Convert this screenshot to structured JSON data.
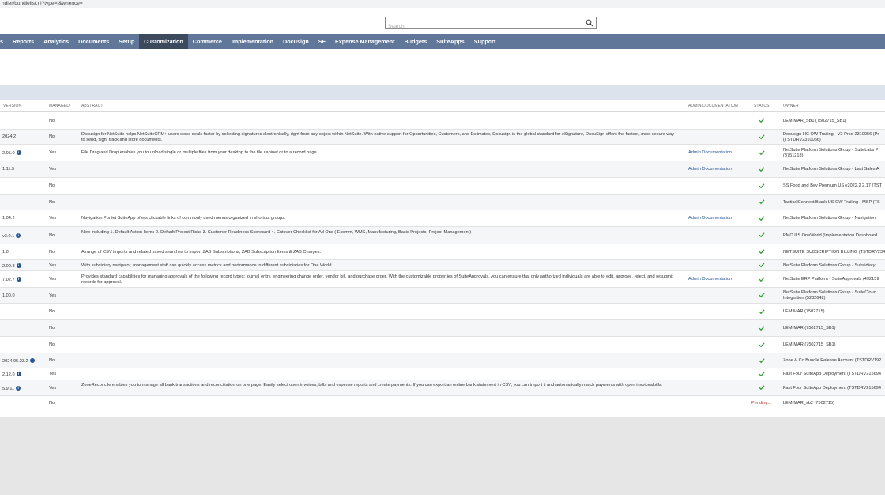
{
  "browser": {
    "url": "ndler/bundlelist.nl?type=I&whence="
  },
  "search": {
    "placeholder": "Search"
  },
  "nav": {
    "items": [
      {
        "label": "s"
      },
      {
        "label": "Reports"
      },
      {
        "label": "Analytics"
      },
      {
        "label": "Documents"
      },
      {
        "label": "Setup"
      },
      {
        "label": "Customization",
        "active": true
      },
      {
        "label": "Commerce"
      },
      {
        "label": "Implementation"
      },
      {
        "label": "Docusign"
      },
      {
        "label": "SF"
      },
      {
        "label": "Expense Management"
      },
      {
        "label": "Budgets"
      },
      {
        "label": "SuiteApps"
      },
      {
        "label": "Support"
      }
    ]
  },
  "table": {
    "headers": {
      "version": "VERSION",
      "managed": "MANAGED",
      "abstract": "ABSTRACT",
      "admin_doc": "ADMIN DOCUMENTATION",
      "status": "STATUS",
      "owner": "OWNER"
    },
    "rows": [
      {
        "version": "",
        "info": false,
        "managed": "No",
        "abstract": "",
        "admin_doc": "",
        "status": "check",
        "owner": "LEM-MAR_SB1 (7502715_SB1)"
      },
      {
        "version": "2024.2",
        "info": false,
        "managed": "No",
        "abstract": "Docusign for NetSuite helps NetSuiteCRM+ users close deals faster by collecting signatures electronically, right from any object within NetSuite. With native support for Opportunities, Customers, and Estimates, Docusign is the global standard for eSignature, DocuSign offers the fastest, most secure way to send, sign, track and store documents.",
        "admin_doc": "",
        "status": "check",
        "owner": "Docusign HC OW Trailing - V2 Prod 2310056 (Pr (TSTDRV2310056)"
      },
      {
        "version": "2.05.0",
        "info": true,
        "managed": "Yes",
        "abstract": "File Drag and Drop enables you to upload single or multiple files from your desktop to the file cabinet or to a record page.",
        "admin_doc": "Admin Documentation",
        "status": "check",
        "owner": "NetSuite Platform Solutions Group - SuiteLabs P (3751218)"
      },
      {
        "version": "1.11.5",
        "info": false,
        "managed": "Yes",
        "abstract": "",
        "admin_doc": "Admin Documentation",
        "status": "check",
        "owner": "NetSuite Platform Solutions Group - Last Sales A"
      },
      {
        "version": "",
        "info": false,
        "managed": "No",
        "abstract": "",
        "admin_doc": "",
        "status": "check",
        "owner": "SS Food and Bev Premium US v2022.2 2.17 (TST"
      },
      {
        "version": "",
        "info": false,
        "managed": "No",
        "abstract": "",
        "admin_doc": "",
        "status": "check",
        "owner": "TacticalConnect Blank US OW Trailing - MSP (TS"
      },
      {
        "version": "1.04.2",
        "info": false,
        "managed": "Yes",
        "abstract": "Navigation Portlet SuiteApp offers clickable links of commonly used menus organized in shortcut groups.",
        "admin_doc": "Admin Documentation",
        "status": "check",
        "owner": "NetSuite Platform Solutions Group - Navigation"
      },
      {
        "version": "v3.0.1",
        "info": true,
        "managed": "No",
        "abstract": "Now including 1. Default Action Items 2. Default Project Risks 3. Customer Readiness Scorecard 4. Cutover Checklist for Ad Ons ( Ecomm, WMS, Manufacturing, Basic Projects, Project Management)",
        "admin_doc": "",
        "status": "check",
        "owner": "PMO US OneWorld (Implementation Dashboard"
      },
      {
        "version": "1.0",
        "info": false,
        "managed": "No",
        "abstract": "A range of CSV imports and related saved searches to import ZAB Subscriptions, ZAB Subscription Items & ZAB Charges.",
        "admin_doc": "",
        "status": "check",
        "owner": "NETSUITE SUBSCRIPTION BILLING (TSTDRV2348"
      },
      {
        "version": "2.00.3",
        "info": true,
        "managed": "Yes",
        "abstract": "With subsidiary navigator, management staff can quickly access metrics and performance in different subsidiaries for One World.",
        "admin_doc": "",
        "status": "check",
        "owner": "NetSuite Platform Solutions Group - Subsidiary"
      },
      {
        "version": "7.02.7",
        "info": true,
        "managed": "Yes",
        "abstract": "Provides standard capabilities for managing approvals of the following record types: journal entry, engineering change order, vendor bill, and purchase order. With the customizable properties of SuiteApprovals, you can ensure that only authorized individuals are able to edit, approve, reject, and resubmit records for approval.",
        "admin_doc": "Admin Documentation",
        "status": "check",
        "owner": "NetSuite ERP Platform - SuiteApprovals (492159"
      },
      {
        "version": "1.00.0",
        "info": false,
        "managed": "Yes",
        "abstract": "",
        "admin_doc": "",
        "status": "check",
        "owner": "NetSuite Platform Solutions Group - SuiteCloud Integration (5232642)"
      },
      {
        "version": "",
        "info": false,
        "managed": "No",
        "abstract": "",
        "admin_doc": "",
        "status": "check",
        "owner": "LEM MAR (7502715)"
      },
      {
        "version": "",
        "info": false,
        "managed": "No",
        "abstract": "",
        "admin_doc": "",
        "status": "check",
        "owner": "LEM-MAR (7502715_SB1)"
      },
      {
        "version": "",
        "info": false,
        "managed": "No",
        "abstract": "",
        "admin_doc": "",
        "status": "check",
        "owner": "LEM-MAR (7502715_SB1)"
      },
      {
        "version": "2024.05.23.2",
        "info": true,
        "managed": "No",
        "abstract": "",
        "admin_doc": "",
        "status": "check",
        "owner": "Zone & Co Bundle Release Account (TSTDRV192"
      },
      {
        "version": "2.12.0",
        "info": true,
        "managed": "Yes",
        "abstract": "",
        "admin_doc": "",
        "status": "check",
        "owner": "Fast Four SuiteApp Deployment (TSTDRV215694"
      },
      {
        "version": "5.9.11",
        "info": true,
        "managed": "Yes",
        "abstract": "ZoneReconcile enables you to manage all bank transactions and reconciliation on one page. Easily select open invoices, bills and expense reports and create payments. If you can export an online bank statement in CSV, you can import it and automatically match payments with open invoices/bills.",
        "admin_doc": "",
        "status": "check",
        "owner": "Fast Four SuiteApp Deployment (TSTDRV215694"
      },
      {
        "version": "",
        "info": false,
        "managed": "No",
        "abstract": "",
        "admin_doc": "",
        "status": "Pending...",
        "owner": "LEM-MAR_sb2 (7502715)"
      }
    ]
  },
  "colors": {
    "nav_bg": "#607799",
    "nav_active": "#3d4a5e",
    "subheader_bg": "#dde3ec",
    "check_green": "#2e9e2e",
    "link_blue": "#255599",
    "pending_red": "#c0392b"
  }
}
